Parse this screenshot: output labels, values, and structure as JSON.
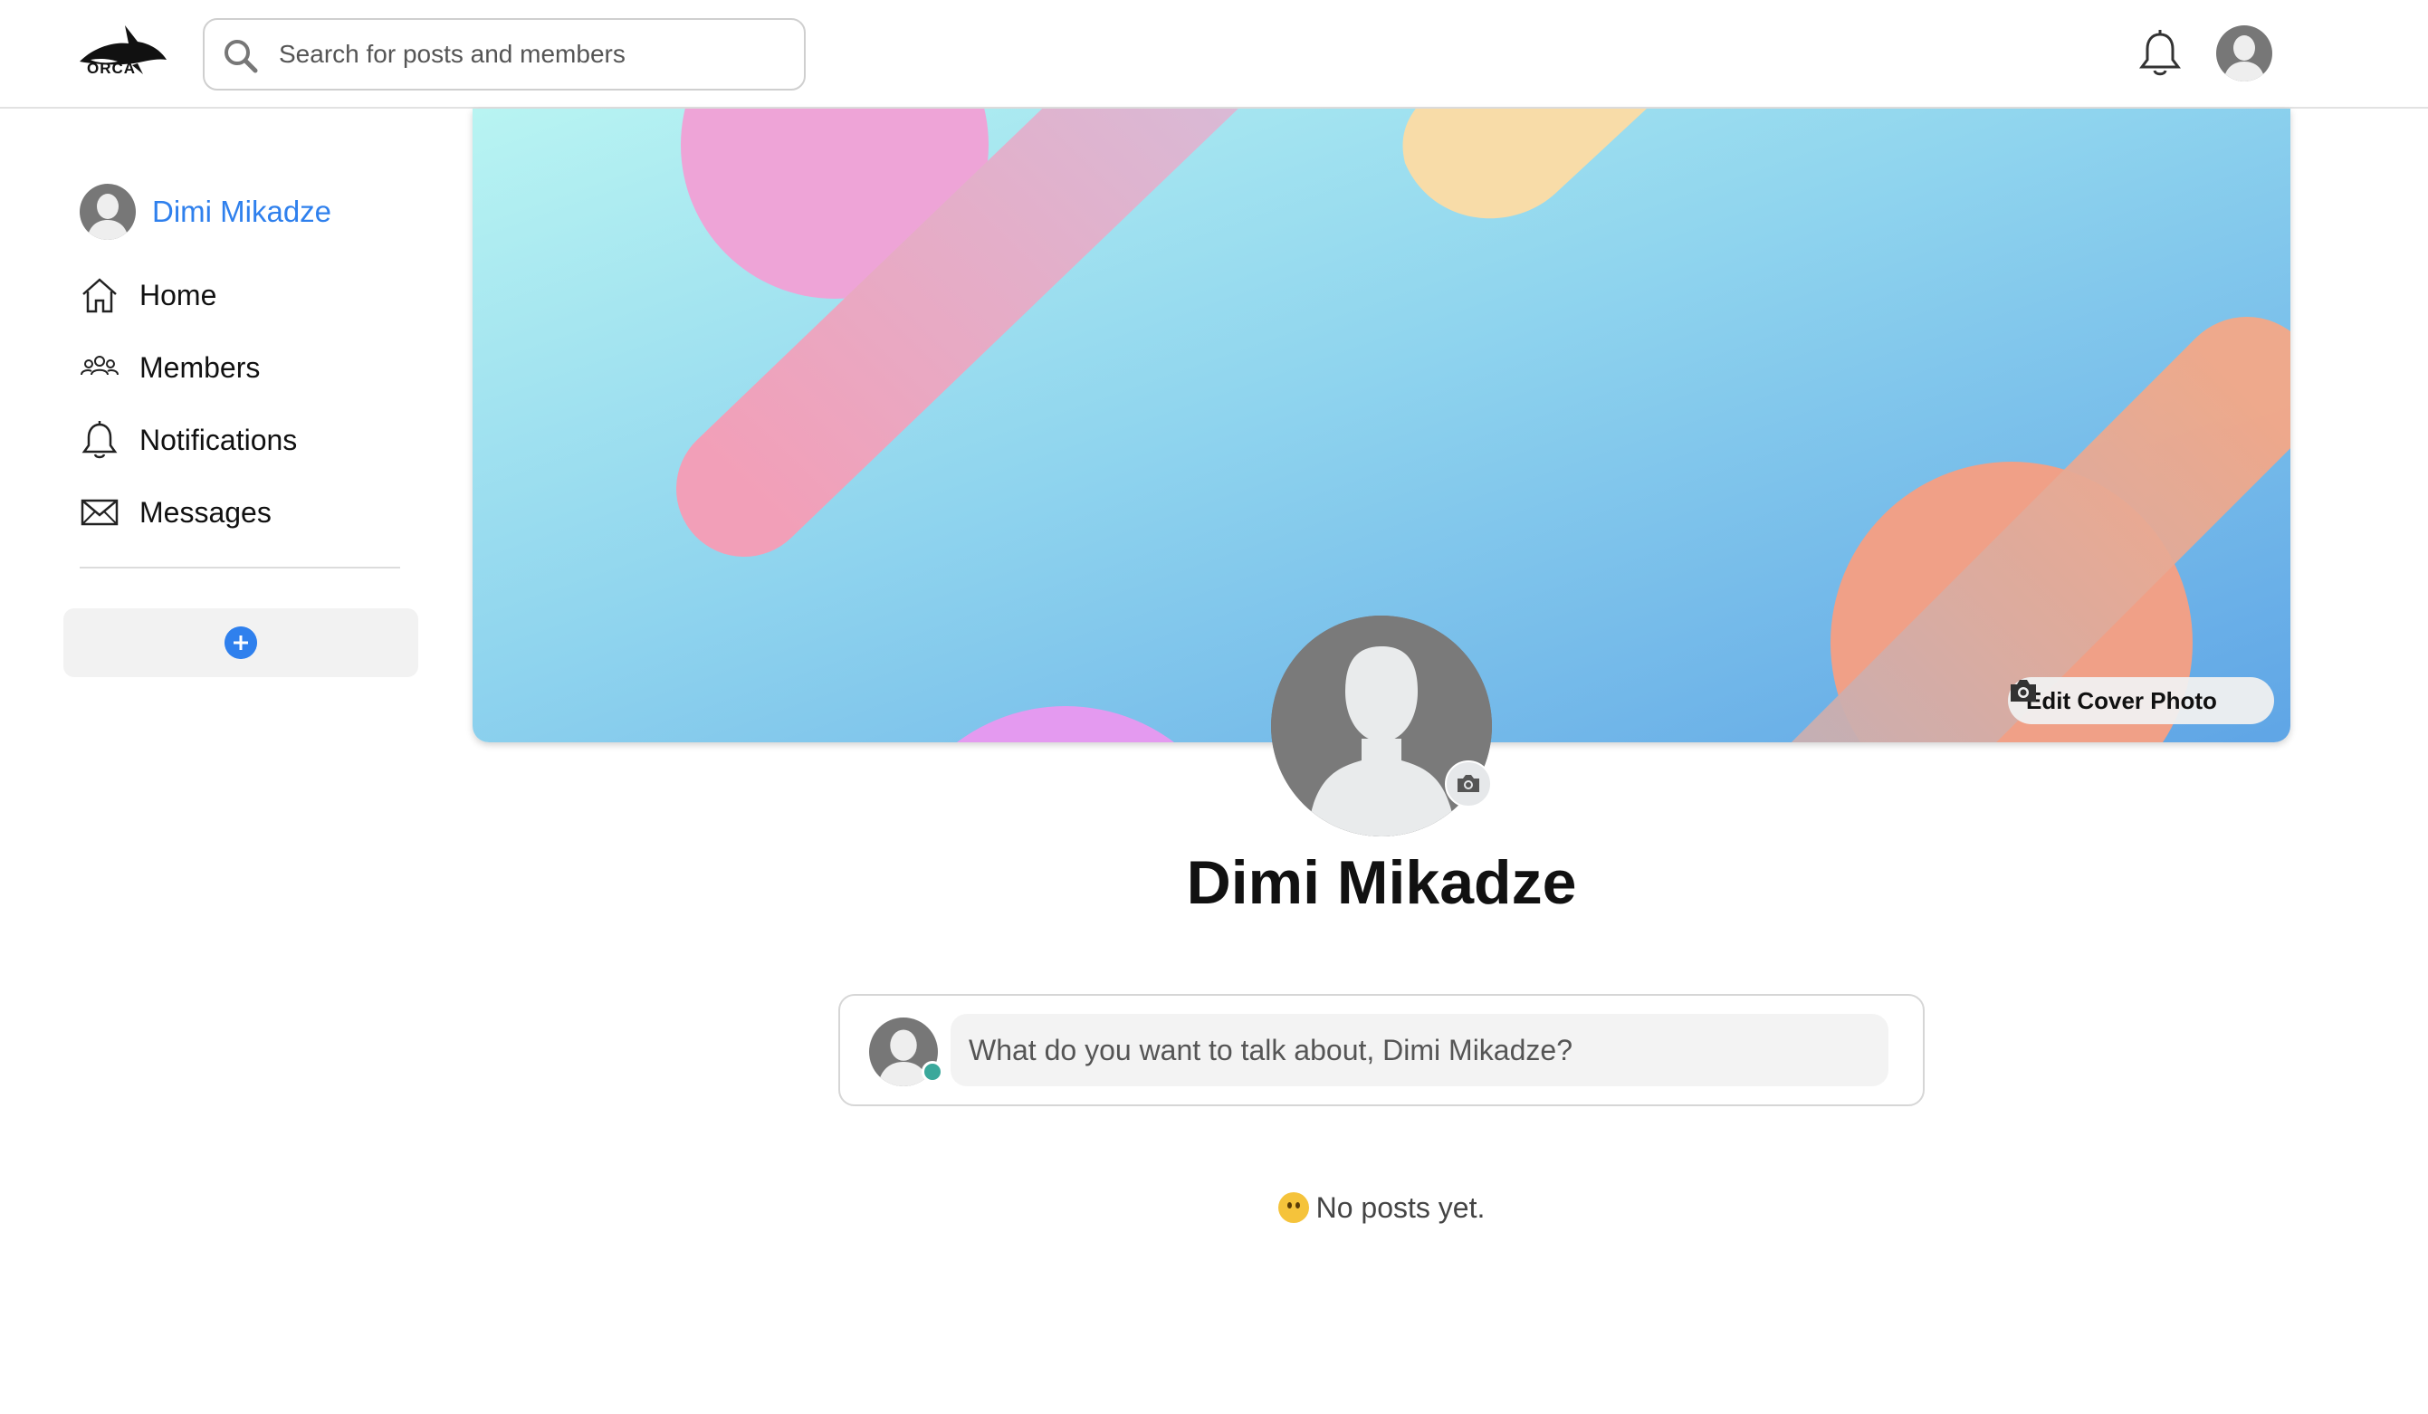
{
  "app": {
    "logo_text": "ORCA"
  },
  "search": {
    "placeholder": "Search for posts and members"
  },
  "sidebar": {
    "profile_name": "Dimi Mikadze",
    "items": [
      {
        "label": "Home",
        "icon": "home-icon"
      },
      {
        "label": "Members",
        "icon": "members-icon"
      },
      {
        "label": "Notifications",
        "icon": "bell-icon"
      },
      {
        "label": "Messages",
        "icon": "envelope-icon"
      }
    ]
  },
  "cover": {
    "edit_label": "Edit Cover Photo"
  },
  "profile": {
    "name": "Dimi Mikadze"
  },
  "composer": {
    "placeholder": "What do you want to talk about, Dimi Mikadze?"
  },
  "feed": {
    "empty_text": "No posts yet."
  },
  "colors": {
    "accent": "#2f80ed",
    "online": "#3aa89b",
    "avatar_gray": "#7a7a7a"
  }
}
